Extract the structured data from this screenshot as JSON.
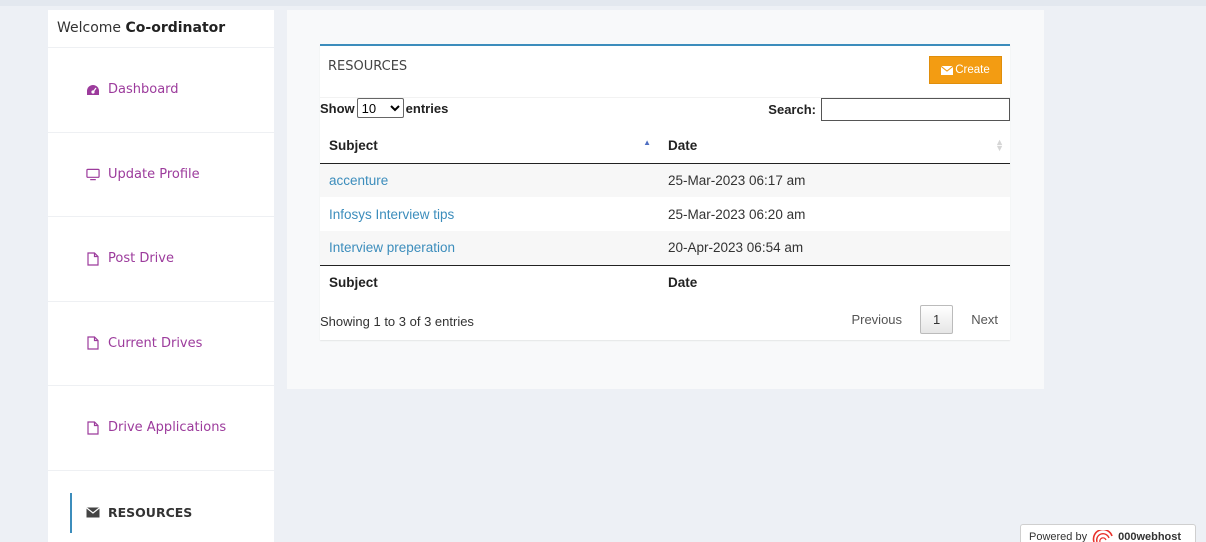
{
  "sidebar": {
    "welcome_prefix": "Welcome",
    "welcome_name": "Co-ordinator",
    "items": [
      {
        "label": "Dashboard",
        "icon": "dashboard-icon"
      },
      {
        "label": "Update Profile",
        "icon": "monitor-icon"
      },
      {
        "label": "Post Drive",
        "icon": "file-icon"
      },
      {
        "label": "Current Drives",
        "icon": "file-icon"
      },
      {
        "label": "Drive Applications",
        "icon": "file-icon"
      },
      {
        "label": "RESOURCES",
        "icon": "envelope-icon",
        "active": true
      }
    ]
  },
  "box": {
    "title": "RESOURCES",
    "create_label": "Create"
  },
  "controls": {
    "show_label": "Show",
    "entries_label": "entries",
    "page_size": "10",
    "search_label": "Search:",
    "search_value": ""
  },
  "table": {
    "columns": [
      "Subject",
      "Date"
    ],
    "rows": [
      {
        "subject": "accenture",
        "date": "25-Mar-2023 06:17 am"
      },
      {
        "subject": "Infosys Interview tips",
        "date": "25-Mar-2023 06:20 am"
      },
      {
        "subject": "Interview preperation",
        "date": "20-Apr-2023 06:54 am"
      }
    ]
  },
  "footer": {
    "info": "Showing 1 to 3 of 3 entries",
    "previous": "Previous",
    "current_page": "1",
    "next": "Next"
  },
  "powered": {
    "prefix": "Powered by",
    "brand": "000webhost"
  },
  "colors": {
    "accent": "#3c8dbc",
    "create_button": "#f39c12",
    "sidebar_link": "#9c3b9c"
  }
}
